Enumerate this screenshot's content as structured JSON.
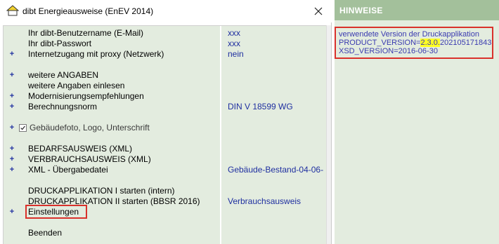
{
  "window": {
    "title": "dibt Energieausweise (EnEV 2014)"
  },
  "icons": {
    "app": "house-icon",
    "close": "close-icon"
  },
  "colors": {
    "panel_bg": "#e3ecdf",
    "header_green": "#a3c09b",
    "value_blue": "#1f2fa0",
    "highlight_red": "#d9312b",
    "highlight_yellow": "#ffff22"
  },
  "rows": [
    {
      "plus": "",
      "label": "Ihr dibt-Benutzername (E-Mail)",
      "value": "xxx"
    },
    {
      "plus": "",
      "label": "Ihr dibt-Passwort",
      "value": "xxx"
    },
    {
      "plus": "+",
      "label": "Internetzugang mit proxy (Netzwerk)",
      "value": "nein"
    },
    {
      "plus": "+",
      "label": "weitere ANGABEN",
      "value": ""
    },
    {
      "plus": "",
      "label": "weitere Angaben einlesen",
      "value": ""
    },
    {
      "plus": "+",
      "label": "Modernisierungsempfehlungen",
      "value": ""
    },
    {
      "plus": "+",
      "label": "Berechnungsnorm",
      "value": "DIN V 18599 WG"
    },
    {
      "plus": "+",
      "label": "Gebäudefoto, Logo, Unterschrift",
      "value": "",
      "checked": true
    },
    {
      "plus": "+",
      "label": "BEDARFSAUSWEIS (XML)",
      "value": ""
    },
    {
      "plus": "+",
      "label": "VERBRAUCHSAUSWEIS (XML)",
      "value": ""
    },
    {
      "plus": "+",
      "label": "XML - Übergabedatei",
      "value": "Gebäude-Bestand-04-06-"
    },
    {
      "plus": "",
      "label": "DRUCKAPPLIKATION I starten (intern)",
      "value": ""
    },
    {
      "plus": "",
      "label": "DRUCKAPPLIKATION II starten (BBSR 2016)",
      "value": "Verbrauchsausweis"
    },
    {
      "plus": "+",
      "label": "Einstellungen",
      "value": ""
    },
    {
      "plus": "",
      "label": "Beenden",
      "value": ""
    }
  ],
  "hinweise": {
    "title": "HINWEISE",
    "line1": "verwendete Version der Druckapplikation",
    "line2_prefix": "PRODUCT_VERSION=",
    "line2_highlight": "2.3.0.",
    "line2_suffix": "202105171843",
    "line3": "XSD_VERSION=2016-06-30"
  }
}
